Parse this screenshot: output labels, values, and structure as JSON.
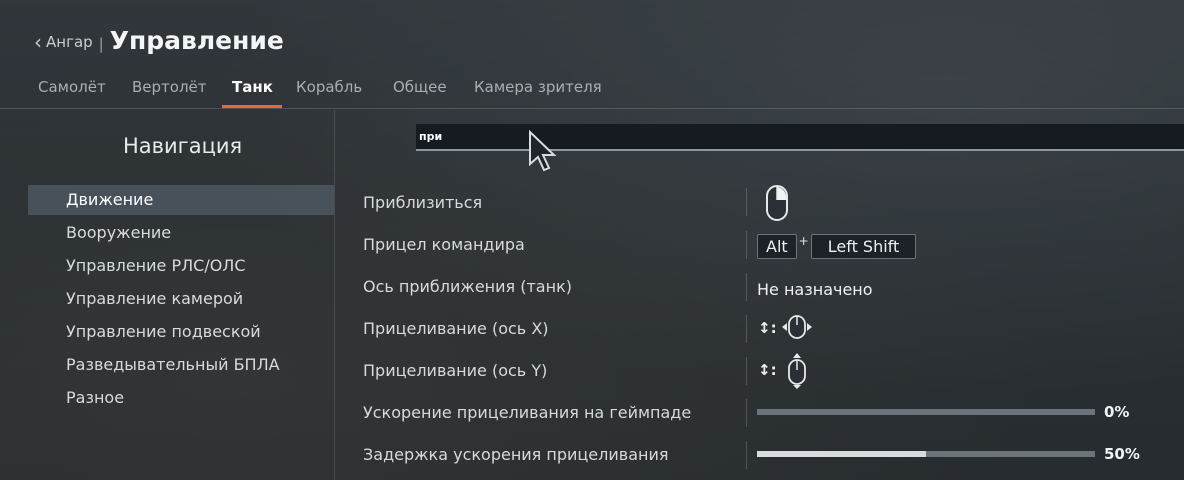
{
  "header": {
    "back_label": "Ангар",
    "separator": "|",
    "title": "Управление"
  },
  "tabs": [
    {
      "label": "Самолёт"
    },
    {
      "label": "Вертолёт"
    },
    {
      "label": "Танк",
      "active": true
    },
    {
      "label": "Корабль"
    },
    {
      "label": "Общее"
    },
    {
      "label": "Камера зрителя"
    }
  ],
  "nav": {
    "title": "Навигация",
    "items": [
      {
        "label": "Движение",
        "active": true
      },
      {
        "label": "Вооружение"
      },
      {
        "label": "Управление РЛС/ОЛС"
      },
      {
        "label": "Управление камерой"
      },
      {
        "label": "Управление подвеской"
      },
      {
        "label": "Разведывательный БПЛА"
      },
      {
        "label": "Разное"
      }
    ]
  },
  "search": {
    "value": "при"
  },
  "rows": [
    {
      "label": "Приблизиться",
      "icon": "mouse-right-button-icon"
    },
    {
      "label": "Прицел командира",
      "keys": [
        "Alt",
        "Left Shift"
      ],
      "plus": "+"
    },
    {
      "label": "Ось приближения (танк)",
      "value": "Не назначено"
    },
    {
      "label": "Прицеливание (ось X)",
      "axis_glyph": "↕:",
      "icon": "mouse-horizontal-axis-icon"
    },
    {
      "label": "Прицеливание (ось Y)",
      "axis_glyph": "↕:",
      "icon": "mouse-vertical-axis-icon"
    },
    {
      "label": "Ускорение прицеливания на геймпаде",
      "percent": "0%",
      "level": 0
    },
    {
      "label": "Задержка ускорения прицеливания",
      "percent": "50%",
      "level": 0.5
    }
  ],
  "colors": {
    "accent": "#e06a3a",
    "active_nav_bg": "#5f6976"
  }
}
